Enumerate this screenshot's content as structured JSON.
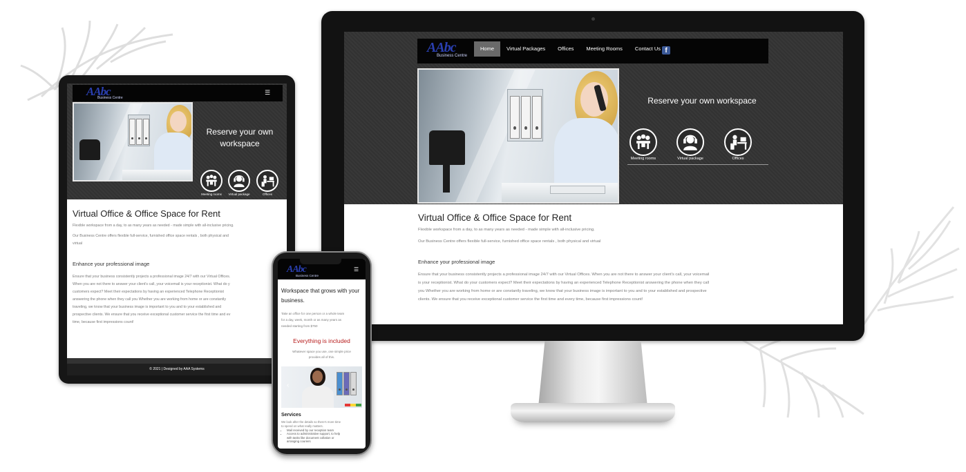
{
  "brand": {
    "logo_text": "AAbc",
    "logo_sub": "Business Centre"
  },
  "desktop": {
    "nav": [
      {
        "label": "Home",
        "active": true
      },
      {
        "label": "Virtual Packages",
        "active": false
      },
      {
        "label": "Offices",
        "active": false
      },
      {
        "label": "Meeting Rooms",
        "active": false
      },
      {
        "label": "Contact Us",
        "active": false
      }
    ],
    "facebook_icon": "facebook-icon",
    "hero_title": "Reserve your own workspace",
    "features": [
      {
        "label": "Meeting rooms",
        "icon": "meeting-icon"
      },
      {
        "label": "Virtual package",
        "icon": "headset-icon"
      },
      {
        "label": "Offices",
        "icon": "desk-icon"
      }
    ],
    "heading": "Virtual Office & Office Space for Rent",
    "intro_1": "Flexible workspace from a day, to as many years as needed - made simple with all-inclusive pricing.",
    "intro_2": "Our Business Centre offers flexible full-service, furnished office space rentals , both physical and virtual",
    "subheading": "Enhance your professional image",
    "body_1": "Ensure that your business consistently projects a professional image 24/7 with our Virtual Offices. When you are not there to answer your client's call, your voicemail",
    "body_2": "is your receptionist. What do your customers expect? Meet their expectations by having an experienced Telephone Receptionist answering the phone when they call",
    "body_3": "you Whether you are working from home or are constantly traveling, we know that your business image is important to you and to your established and prospective",
    "body_4": "clients. We ensure that you receive exceptional customer service the first time and every time, because first impressions count!"
  },
  "tablet": {
    "hero_title_1": "Reserve your own",
    "hero_title_2": "workspace",
    "features": [
      {
        "label": "Meeting rooms"
      },
      {
        "label": "Virtual package"
      },
      {
        "label": "Offices"
      }
    ],
    "heading": "Virtual Office & Office Space for Rent",
    "intro_1": "Flexible workspace from a day, to as many years as needed - made simple with all-inclusive pricing.",
    "intro_2a": "Our Business Centre offers flexible full-service, furnished office space rentals , both physical and",
    "intro_2b": "virtual",
    "subheading": "Enhance your professional image",
    "body": [
      "Ensure that your business consistently projects a professional image 24/7 with our Virtual Offices.",
      "When you are not there to answer your client's call, your voicemail is your receptionist. What do y",
      "customers expect? Meet their expectations by having an experienced Telephone Receptionist",
      "answering the phone when they call you Whether you are working from home or are constantly",
      "traveling, we know that your business image is important to you and to your established and",
      "prospective clients. We ensure that you receive exceptional customer service the first time and ev",
      "time, because first impressions count!"
    ],
    "footer": "© 2021 | Designed by AAA Systems"
  },
  "phone": {
    "heading_1": "Workspace that grows with your",
    "heading_2": "business.",
    "text": [
      "Take an office for one person or a whole team",
      "for a day, week, month or as many years as",
      "needed starting from $750"
    ],
    "included": "Everything is included",
    "included_text_1": "Whatever space you use, one simple price",
    "included_text_2": "provides all of this.",
    "services": "Services",
    "services_text_1": "We look after the details so there's more time",
    "services_text_2": "to spend on what really matters.",
    "services_list": [
      "Mail received by our reception team",
      "Access to administrative support, to help",
      "with tasks like document collation or",
      "arranging couriers"
    ]
  },
  "colors": {
    "logo": "#2a3fb0",
    "nav_bg": "#050505",
    "active_nav": "#6a6a6a",
    "hero_bg": "#333333",
    "accent_red": "#b71c1c"
  }
}
